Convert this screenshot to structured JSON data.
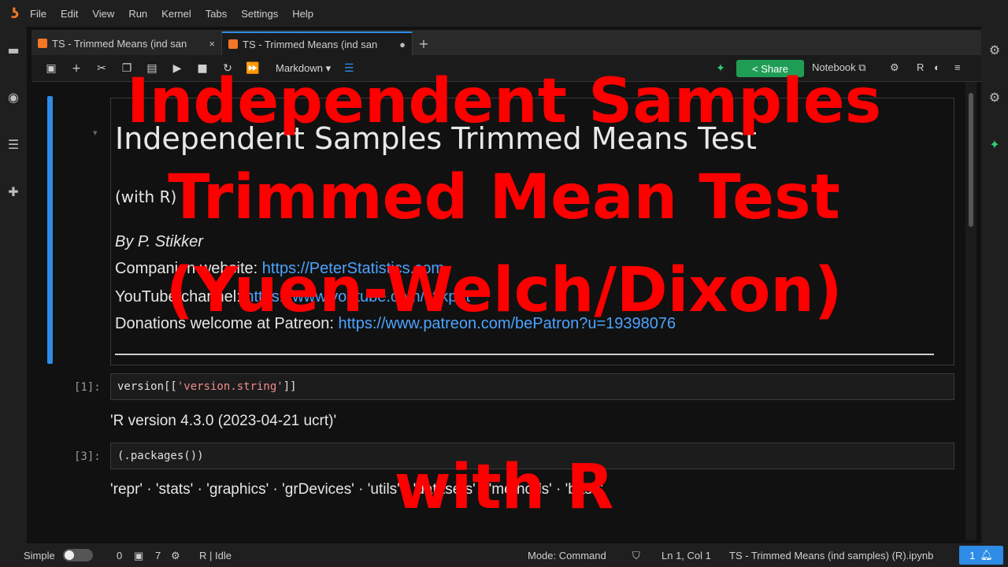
{
  "menubar": {
    "items": [
      "File",
      "Edit",
      "View",
      "Run",
      "Kernel",
      "Tabs",
      "Settings",
      "Help"
    ]
  },
  "tabs": [
    {
      "label": "TS - Trimmed Means (ind san",
      "close": "×"
    },
    {
      "label": "TS - Trimmed Means (ind san",
      "close": "●"
    }
  ],
  "toolbar": {
    "cell_type": "Markdown",
    "share_label": "Share",
    "notebook_label": "Notebook",
    "kernel_label": "R"
  },
  "notebook": {
    "heading": "Independent Samples Trimmed Means Test",
    "subheading": "(with R)",
    "author": "By P. Stikker",
    "companion_prefix": "Companion website: ",
    "companion_link": "https://PeterStatistics.com",
    "youtube_prefix": "YouTube channel: ",
    "youtube_link": "https://www.youtube.com/stikpet",
    "donations_prefix": "Donations welcome at Patreon: ",
    "donations_link": "https://www.patreon.com/bePatron?u=19398076",
    "cells": [
      {
        "prompt": "[1]:",
        "code_pre": "version[[",
        "code_str": "'version.string'",
        "code_post": "]]",
        "output": "'R version 4.3.0 (2023-04-21 ucrt)'"
      },
      {
        "prompt": "[3]:",
        "code_pre": "(.packages())",
        "code_str": "",
        "code_post": "",
        "output": "'repr' · 'stats' · 'graphics' · 'grDevices' · 'utils' · 'datasets' · 'methods' · 'base'"
      }
    ]
  },
  "statusbar": {
    "mode_simple": "Simple",
    "count_a": "0",
    "count_b": "7",
    "kernel_status": "R | Idle",
    "mode": "Mode: Command",
    "position": "Ln 1, Col 1",
    "filename": "TS - Trimmed Means (ind samples) (R).ipynb",
    "notifications": "1"
  },
  "overlay": {
    "line1": "Independent Samples",
    "line2": "Trimmed Mean Test",
    "line3": "(Yuen-Welch/Dixon)",
    "line4": "with R"
  },
  "colors": {
    "accent": "#2e8ce6",
    "share": "#1f9d55",
    "overlay": "#ff0000",
    "link": "#4da3ff"
  }
}
